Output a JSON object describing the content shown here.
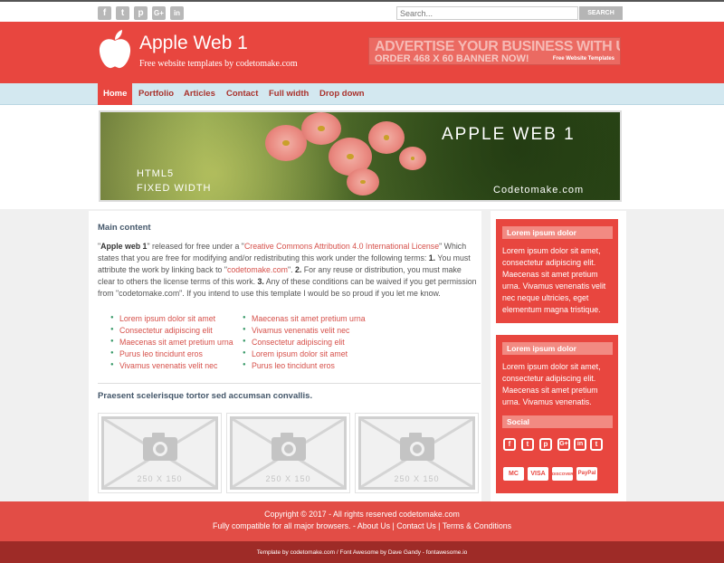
{
  "topbar": {
    "social_icons": [
      "facebook-icon",
      "twitter-icon",
      "pinterest-icon",
      "google-plus-icon",
      "linkedin-icon"
    ],
    "search_placeholder": "Search...",
    "search_button": "SEARCH"
  },
  "header": {
    "title": "Apple Web 1",
    "tagline": "Free website templates by codetomake.com",
    "ad": {
      "line1": "ADVERTISE YOUR BUSINESS WITH US",
      "line2": "ORDER 468 X 60 BANNER NOW!",
      "line3": "Free Website Templates"
    }
  },
  "nav": [
    "Home",
    "Portfolio",
    "Articles",
    "Contact",
    "Full width",
    "Drop down"
  ],
  "hero": {
    "title": "APPLE WEB 1",
    "line1": "HTML5",
    "line2": "FIXED WIDTH",
    "site": "Codetomake.com"
  },
  "main": {
    "heading": "Main content",
    "intro": {
      "q1": "\"",
      "name": "Apple web 1",
      "q2": "\" released for free under a \"",
      "license": "Creative Commons Attribution 4.0 International License",
      "t1": "\" Which states that you are free for modifying and/or redistributing this work under the following terms: ",
      "n1": "1.",
      "t2": " You must attribute the work by linking back to \"",
      "link": "codetomake.com",
      "t3": "\". ",
      "n2": "2.",
      "t4": " For any reuse or distribution, you must make clear to others the license terms of this work. ",
      "n3": "3.",
      "t5": " Any of these conditions can be waived if you get permission from \"codetomake.com\". If you intend to use this template I would be so proud if you let me know."
    },
    "list_left": [
      "Lorem ipsum dolor sit amet",
      "Consectetur adipiscing elit",
      "Maecenas sit amet pretium urna",
      "Purus leo tincidunt eros",
      "Vivamus venenatis velit nec"
    ],
    "list_right": [
      "Maecenas sit amet pretium urna",
      "Vivamus venenatis velit nec",
      "Consectetur adipiscing elit",
      "Lorem ipsum dolor sit amet",
      "Purus leo tincidunt eros"
    ],
    "section_heading": "Praesent scelerisque tortor sed accumsan convallis.",
    "placeholders": [
      "250 X 150",
      "250 X 150",
      "250 X 150"
    ]
  },
  "sidebar": {
    "box1": {
      "title": "Lorem ipsum dolor",
      "text": "Lorem ipsum dolor sit amet, consectetur adipiscing elit. Maecenas sit amet pretium urna. Vivamus venenatis velit nec neque ultricies, eget elementum magna tristique."
    },
    "box2": {
      "title": "Lorem ipsum dolor",
      "text": "Lorem ipsum dolor sit amet, consectetur adipiscing elit. Maecenas sit amet pretium urna. Vivamus venenatis."
    },
    "social_title": "Social",
    "social_icons": [
      "facebook-icon",
      "twitter-icon",
      "pinterest-icon",
      "google-plus-icon",
      "linkedin-icon",
      "tumblr-icon"
    ],
    "payment_icons": [
      "mastercard-icon",
      "visa-icon",
      "discover-icon",
      "paypal-icon"
    ],
    "payment_labels": [
      "MC",
      "VISA",
      "DISCOVER",
      "PayPal"
    ]
  },
  "footer": {
    "copyright": "Copyright © 2017 - All rights reserved codetomake.com",
    "tagline": "Fully compatible for all major browsers. - ",
    "link_about": "About Us",
    "sep1": " | ",
    "link_contact": "Contact Us",
    "sep2": " | ",
    "link_terms": "Terms & Conditions",
    "credit": "Template by codetomake.com / Font Awesome by Dave Gandy - fontawesome.io"
  },
  "colors": {
    "accent": "#e8463f",
    "nav_bg": "#d3e8f0",
    "footer_dark": "#9e2b27"
  }
}
